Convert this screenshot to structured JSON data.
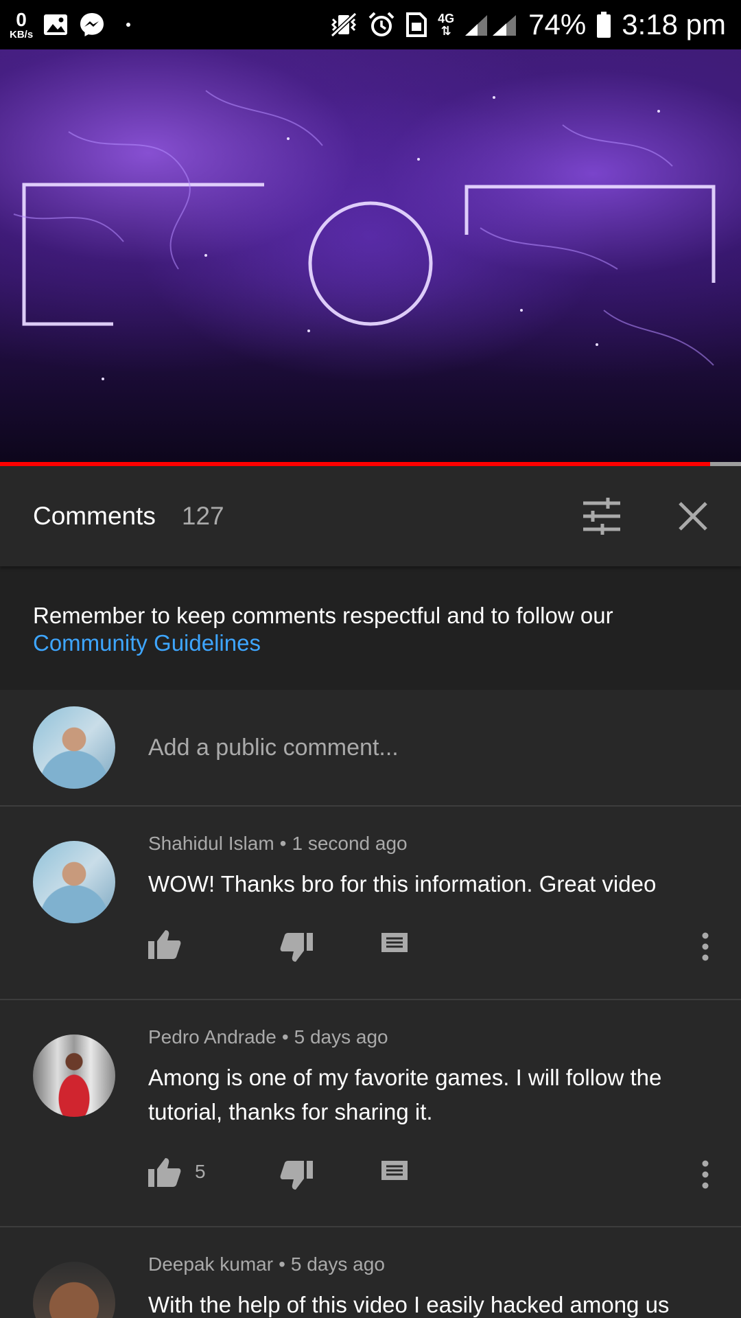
{
  "status_bar": {
    "net_speed_value": "0",
    "net_speed_unit": "KB/s",
    "network_type": "4G",
    "battery": "74%",
    "time": "3:18 pm"
  },
  "video": {
    "progress_fraction": 0.958
  },
  "comments_panel": {
    "title": "Comments",
    "count": "127"
  },
  "guidelines": {
    "text": "Remember to keep comments respectful and to follow our",
    "link": "Community Guidelines"
  },
  "add_comment": {
    "placeholder": "Add a public comment..."
  },
  "comments": [
    {
      "author": "Shahidul Islam",
      "time": "1 second ago",
      "text": "WOW! Thanks bro for this information. Great video",
      "likes": ""
    },
    {
      "author": "Pedro Andrade",
      "time": "5 days ago",
      "text": "Among is one of my favorite games. I will follow the tutorial, thanks for sharing it.",
      "likes": "5"
    },
    {
      "author": "Deepak kumar",
      "time": "5 days ago",
      "text": "With the help of this video I easily hacked among us",
      "likes": ""
    }
  ],
  "colors": {
    "background": "#282828",
    "banner_background": "#212121",
    "link": "#3ea6ff",
    "progress": "#ff0000",
    "secondary_text": "#aaaaaa"
  },
  "icons": [
    "image-icon",
    "messenger-icon",
    "vibrate-icon",
    "alarm-icon",
    "sim-icon",
    "signal-icon",
    "battery-icon",
    "filter-icon",
    "close-icon",
    "thumbs-up-icon",
    "thumbs-down-icon",
    "reply-icon",
    "more-icon"
  ]
}
